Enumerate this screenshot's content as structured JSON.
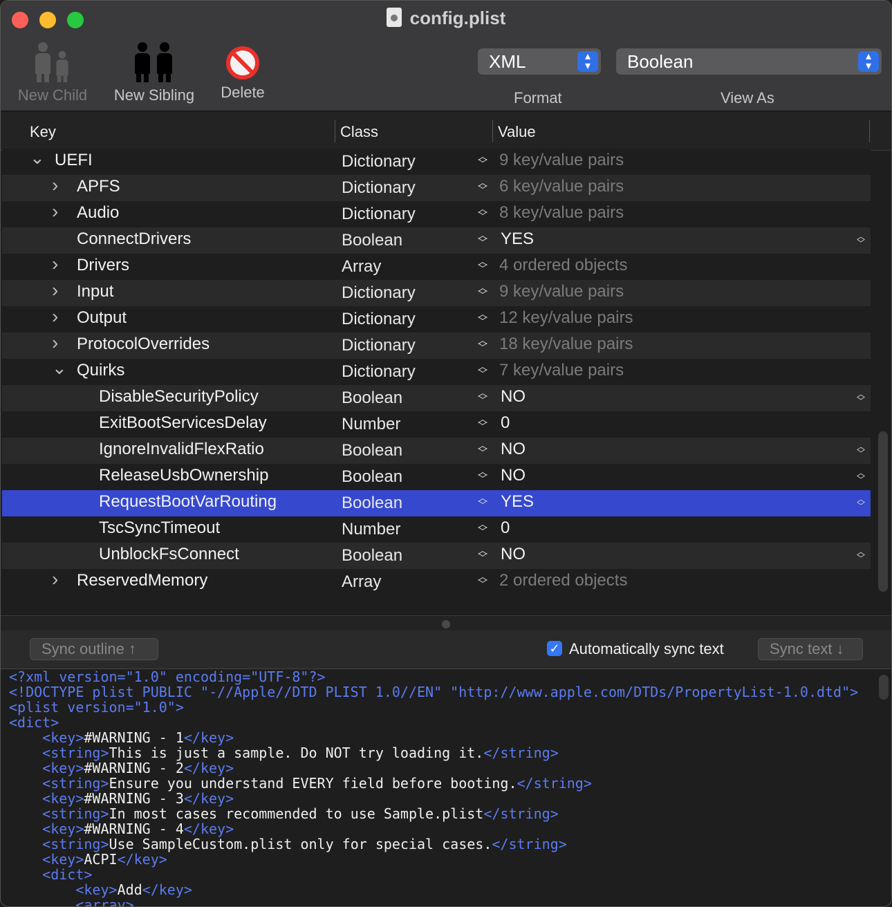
{
  "window": {
    "title": "config.plist"
  },
  "toolbar": {
    "new_child": "New Child",
    "new_sibling": "New Sibling",
    "delete": "Delete",
    "format_value": "XML",
    "format_label": "Format",
    "view_as_value": "Boolean",
    "view_as_label": "View As"
  },
  "columns": {
    "key": "Key",
    "class": "Class",
    "value": "Value"
  },
  "rows": [
    {
      "key": "UEFI",
      "class": "Dictionary",
      "value": "9 key/value pairs",
      "disclosure": "expanded",
      "level": 0
    },
    {
      "key": "APFS",
      "class": "Dictionary",
      "value": "6 key/value pairs",
      "disclosure": "collapsed",
      "level": 1
    },
    {
      "key": "Audio",
      "class": "Dictionary",
      "value": "8 key/value pairs",
      "disclosure": "collapsed",
      "level": 1
    },
    {
      "key": "ConnectDrivers",
      "class": "Boolean",
      "value": "YES",
      "disclosure": "none",
      "level": 1
    },
    {
      "key": "Drivers",
      "class": "Array",
      "value": "4 ordered objects",
      "disclosure": "collapsed",
      "level": 1
    },
    {
      "key": "Input",
      "class": "Dictionary",
      "value": "9 key/value pairs",
      "disclosure": "collapsed",
      "level": 1
    },
    {
      "key": "Output",
      "class": "Dictionary",
      "value": "12 key/value pairs",
      "disclosure": "collapsed",
      "level": 1
    },
    {
      "key": "ProtocolOverrides",
      "class": "Dictionary",
      "value": "18 key/value pairs",
      "disclosure": "collapsed",
      "level": 1
    },
    {
      "key": "Quirks",
      "class": "Dictionary",
      "value": "7 key/value pairs",
      "disclosure": "expanded",
      "level": 1
    },
    {
      "key": "DisableSecurityPolicy",
      "class": "Boolean",
      "value": "NO",
      "disclosure": "none",
      "level": 2
    },
    {
      "key": "ExitBootServicesDelay",
      "class": "Number",
      "value": "0",
      "disclosure": "none",
      "level": 2
    },
    {
      "key": "IgnoreInvalidFlexRatio",
      "class": "Boolean",
      "value": "NO",
      "disclosure": "none",
      "level": 2
    },
    {
      "key": "ReleaseUsbOwnership",
      "class": "Boolean",
      "value": "NO",
      "disclosure": "none",
      "level": 2
    },
    {
      "key": "RequestBootVarRouting",
      "class": "Boolean",
      "value": "YES",
      "disclosure": "none",
      "level": 2,
      "selected": true
    },
    {
      "key": "TscSyncTimeout",
      "class": "Number",
      "value": "0",
      "disclosure": "none",
      "level": 2
    },
    {
      "key": "UnblockFsConnect",
      "class": "Boolean",
      "value": "NO",
      "disclosure": "none",
      "level": 2
    },
    {
      "key": "ReservedMemory",
      "class": "Array",
      "value": "2 ordered objects",
      "disclosure": "collapsed",
      "level": 1
    }
  ],
  "sync": {
    "sync_outline": "Sync outline ↑",
    "auto_sync": "Automatically sync text",
    "auto_sync_checked": true,
    "sync_text": "Sync text ↓"
  },
  "xml_lines": [
    "<?xml version=\"1.0\" encoding=\"UTF-8\"?>",
    "<!DOCTYPE plist PUBLIC \"-//Apple//DTD PLIST 1.0//EN\" \"http://www.apple.com/DTDs/PropertyList-1.0.dtd\">",
    "<plist version=\"1.0\">",
    "<dict>",
    "    <key>#WARNING - 1</key>",
    "    <string>This is just a sample. Do NOT try loading it.</string>",
    "    <key>#WARNING - 2</key>",
    "    <string>Ensure you understand EVERY field before booting.</string>",
    "    <key>#WARNING - 3</key>",
    "    <string>In most cases recommended to use Sample.plist</string>",
    "    <key>#WARNING - 4</key>",
    "    <string>Use SampleCustom.plist only for special cases.</string>",
    "    <key>ACPI</key>",
    "    <dict>",
    "        <key>Add</key>",
    "        <array>"
  ],
  "colors": {
    "selection": "#3548ce",
    "accent": "#3478f6",
    "xml_tag": "#5b7cf2"
  }
}
